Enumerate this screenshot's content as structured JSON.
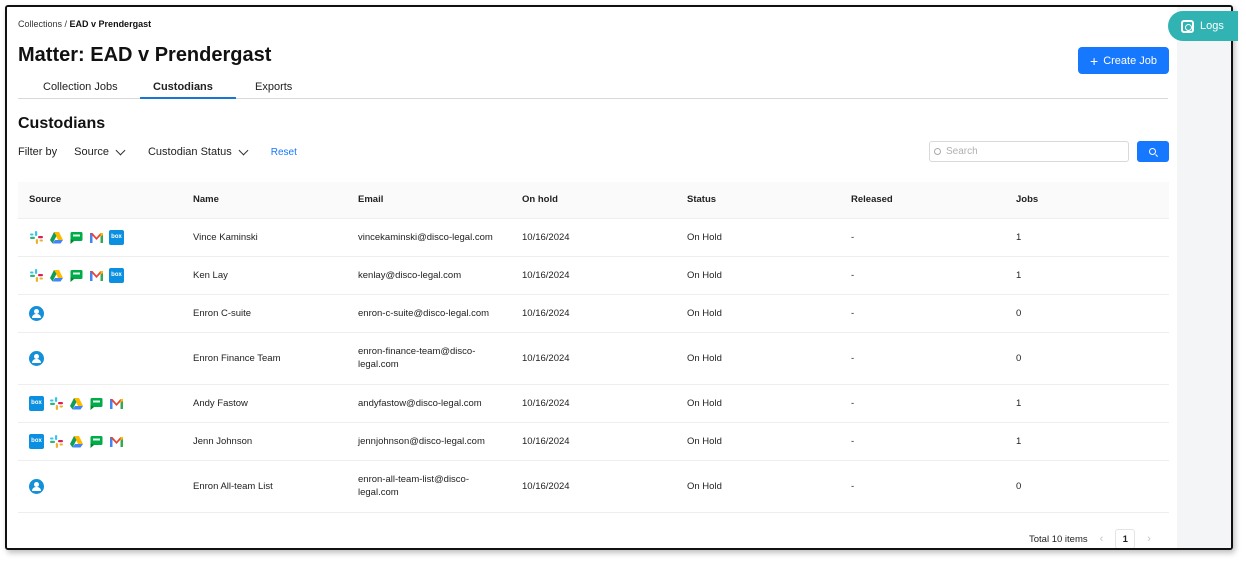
{
  "breadcrumb": {
    "parent": "Collections",
    "separator": " / ",
    "current": "EAD v Prendergast"
  },
  "page_title": "Matter: EAD v Prendergast",
  "tabs": [
    {
      "label": "Collection Jobs",
      "active": false
    },
    {
      "label": "Custodians",
      "active": true
    },
    {
      "label": "Exports",
      "active": false
    }
  ],
  "create_job": {
    "label": "Create Job",
    "icon": "plus-icon"
  },
  "logs": {
    "label": "Logs",
    "icon": "logs-icon",
    "color": "#31b3b3"
  },
  "section_title": "Custodians",
  "filters": {
    "label": "Filter by",
    "source": "Source",
    "custodian_status": "Custodian Status",
    "reset": "Reset"
  },
  "search": {
    "placeholder": "Search"
  },
  "table": {
    "columns": [
      "Source",
      "Name",
      "Email",
      "On hold",
      "Status",
      "Released",
      "Jobs"
    ],
    "rows": [
      {
        "sources": [
          "slack-icon",
          "google-drive-icon",
          "google-chat-icon",
          "gmail-icon",
          "box-icon"
        ],
        "name": "Vince Kaminski",
        "email": "vincekaminski@disco-legal.com",
        "on_hold": "10/16/2024",
        "status": "On Hold",
        "released": "-",
        "jobs": "1"
      },
      {
        "sources": [
          "slack-icon",
          "google-drive-icon",
          "google-chat-icon",
          "gmail-icon",
          "box-icon"
        ],
        "name": "Ken Lay",
        "email": "kenlay@disco-legal.com",
        "on_hold": "10/16/2024",
        "status": "On Hold",
        "released": "-",
        "jobs": "1"
      },
      {
        "sources": [
          "group-icon"
        ],
        "name": "Enron C-suite",
        "email": "enron-c-suite@disco-legal.com",
        "on_hold": "10/16/2024",
        "status": "On Hold",
        "released": "-",
        "jobs": "0"
      },
      {
        "sources": [
          "group-icon"
        ],
        "name": "Enron Finance Team",
        "email": "enron-finance-team@disco-legal.com",
        "on_hold": "10/16/2024",
        "status": "On Hold",
        "released": "-",
        "jobs": "0"
      },
      {
        "sources": [
          "box-icon",
          "slack-icon",
          "google-drive-icon",
          "google-chat-icon",
          "gmail-icon"
        ],
        "name": "Andy Fastow",
        "email": "andyfastow@disco-legal.com",
        "on_hold": "10/16/2024",
        "status": "On Hold",
        "released": "-",
        "jobs": "1"
      },
      {
        "sources": [
          "box-icon",
          "slack-icon",
          "google-drive-icon",
          "google-chat-icon",
          "gmail-icon"
        ],
        "name": "Jenn Johnson",
        "email": "jennjohnson@disco-legal.com",
        "on_hold": "10/16/2024",
        "status": "On Hold",
        "released": "-",
        "jobs": "1"
      },
      {
        "sources": [
          "group-icon"
        ],
        "name": "Enron All-team List",
        "email": "enron-all-team-list@disco-legal.com",
        "on_hold": "10/16/2024",
        "status": "On Hold",
        "released": "-",
        "jobs": "0"
      }
    ]
  },
  "pagination": {
    "total": "Total 10 items",
    "current_page": "1"
  },
  "colors": {
    "accent": "#1677ff",
    "tab_underline": "#1976d2"
  }
}
